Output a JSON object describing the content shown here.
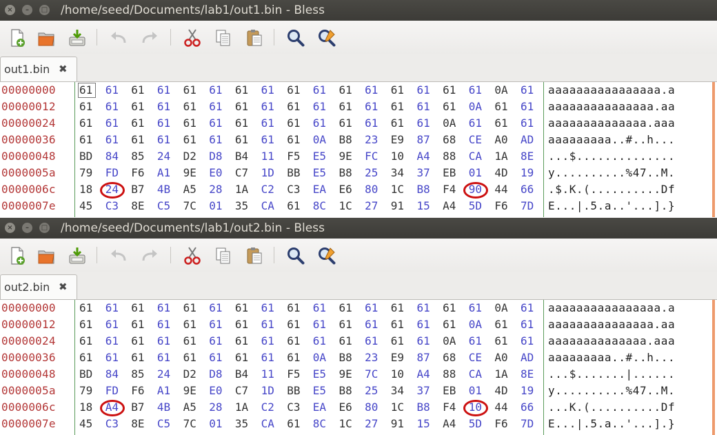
{
  "windows": [
    {
      "title": "/home/seed/Documents/lab1/out1.bin - Bless",
      "tab_label": "out1.bin",
      "offsets": [
        "00000000",
        "00000012",
        "00000024",
        "00000036",
        "00000048",
        "0000005a",
        "0000006c",
        "0000007e"
      ],
      "hex_rows": [
        [
          "61",
          "61",
          "61",
          "61",
          "61",
          "61",
          "61",
          "61",
          "61",
          "61",
          "61",
          "61",
          "61",
          "61",
          "61",
          "61",
          "0A",
          "61"
        ],
        [
          "61",
          "61",
          "61",
          "61",
          "61",
          "61",
          "61",
          "61",
          "61",
          "61",
          "61",
          "61",
          "61",
          "61",
          "61",
          "0A",
          "61",
          "61"
        ],
        [
          "61",
          "61",
          "61",
          "61",
          "61",
          "61",
          "61",
          "61",
          "61",
          "61",
          "61",
          "61",
          "61",
          "61",
          "0A",
          "61",
          "61",
          "61"
        ],
        [
          "61",
          "61",
          "61",
          "61",
          "61",
          "61",
          "61",
          "61",
          "61",
          "0A",
          "B8",
          "23",
          "E9",
          "87",
          "68",
          "CE",
          "A0",
          "AD"
        ],
        [
          "BD",
          "84",
          "85",
          "24",
          "D2",
          "D8",
          "B4",
          "11",
          "F5",
          "E5",
          "9E",
          "FC",
          "10",
          "A4",
          "88",
          "CA",
          "1A",
          "8E"
        ],
        [
          "79",
          "FD",
          "F6",
          "A1",
          "9E",
          "E0",
          "C7",
          "1D",
          "BB",
          "E5",
          "B8",
          "25",
          "34",
          "37",
          "EB",
          "01",
          "4D",
          "19"
        ],
        [
          "18",
          "24",
          "B7",
          "4B",
          "A5",
          "28",
          "1A",
          "C2",
          "C3",
          "EA",
          "E6",
          "80",
          "1C",
          "B8",
          "F4",
          "90",
          "44",
          "66"
        ],
        [
          "45",
          "C3",
          "8E",
          "C5",
          "7C",
          "01",
          "35",
          "CA",
          "61",
          "8C",
          "1C",
          "27",
          "91",
          "15",
          "A4",
          "5D",
          "F6",
          "7D"
        ]
      ],
      "ascii_rows": [
        "aaaaaaaaaaaaaaaa.a",
        "aaaaaaaaaaaaaaa.aa",
        "aaaaaaaaaaaaaa.aaa",
        "aaaaaaaaa..#..h...",
        "...$..............",
        "y..........%47..M.",
        ".$.K.(..........Df",
        "E...|.5.a..'...].}"
      ],
      "highlighted_bytes": [
        "24",
        "90"
      ]
    },
    {
      "title": "/home/seed/Documents/lab1/out2.bin - Bless",
      "tab_label": "out2.bin",
      "offsets": [
        "00000000",
        "00000012",
        "00000024",
        "00000036",
        "00000048",
        "0000005a",
        "0000006c",
        "0000007e"
      ],
      "hex_rows": [
        [
          "61",
          "61",
          "61",
          "61",
          "61",
          "61",
          "61",
          "61",
          "61",
          "61",
          "61",
          "61",
          "61",
          "61",
          "61",
          "61",
          "0A",
          "61"
        ],
        [
          "61",
          "61",
          "61",
          "61",
          "61",
          "61",
          "61",
          "61",
          "61",
          "61",
          "61",
          "61",
          "61",
          "61",
          "61",
          "0A",
          "61",
          "61"
        ],
        [
          "61",
          "61",
          "61",
          "61",
          "61",
          "61",
          "61",
          "61",
          "61",
          "61",
          "61",
          "61",
          "61",
          "61",
          "0A",
          "61",
          "61",
          "61"
        ],
        [
          "61",
          "61",
          "61",
          "61",
          "61",
          "61",
          "61",
          "61",
          "61",
          "0A",
          "B8",
          "23",
          "E9",
          "87",
          "68",
          "CE",
          "A0",
          "AD"
        ],
        [
          "BD",
          "84",
          "85",
          "24",
          "D2",
          "D8",
          "B4",
          "11",
          "F5",
          "E5",
          "9E",
          "7C",
          "10",
          "A4",
          "88",
          "CA",
          "1A",
          "8E"
        ],
        [
          "79",
          "FD",
          "F6",
          "A1",
          "9E",
          "E0",
          "C7",
          "1D",
          "BB",
          "E5",
          "B8",
          "25",
          "34",
          "37",
          "EB",
          "01",
          "4D",
          "19"
        ],
        [
          "18",
          "A4",
          "B7",
          "4B",
          "A5",
          "28",
          "1A",
          "C2",
          "C3",
          "EA",
          "E6",
          "80",
          "1C",
          "B8",
          "F4",
          "10",
          "44",
          "66"
        ],
        [
          "45",
          "C3",
          "8E",
          "C5",
          "7C",
          "01",
          "35",
          "CA",
          "61",
          "8C",
          "1C",
          "27",
          "91",
          "15",
          "A4",
          "5D",
          "F6",
          "7D"
        ]
      ],
      "ascii_rows": [
        "aaaaaaaaaaaaaaaa.a",
        "aaaaaaaaaaaaaaa.aa",
        "aaaaaaaaaaaaaa.aaa",
        "aaaaaaaaa..#..h...",
        "...$.......|......",
        "y..........%47..M.",
        "...K.(..........Df",
        "E...|.5.a..'...].}"
      ],
      "highlighted_bytes": [
        "A4",
        "10"
      ]
    }
  ],
  "toolbar_icons": [
    "new-file-icon",
    "open-folder-icon",
    "save-icon",
    "undo-icon",
    "redo-icon",
    "cut-icon",
    "copy-icon",
    "paste-icon",
    "find-icon",
    "find-replace-icon"
  ],
  "colors": {
    "titlebar": "#3c3b37",
    "offset_text": "#b33636",
    "byte_even": "#333333",
    "byte_odd": "#4646c8",
    "highlight_circle": "#cc1010",
    "column_divider": "#5a9a5a",
    "scroll_marker": "#ee9a6c"
  }
}
